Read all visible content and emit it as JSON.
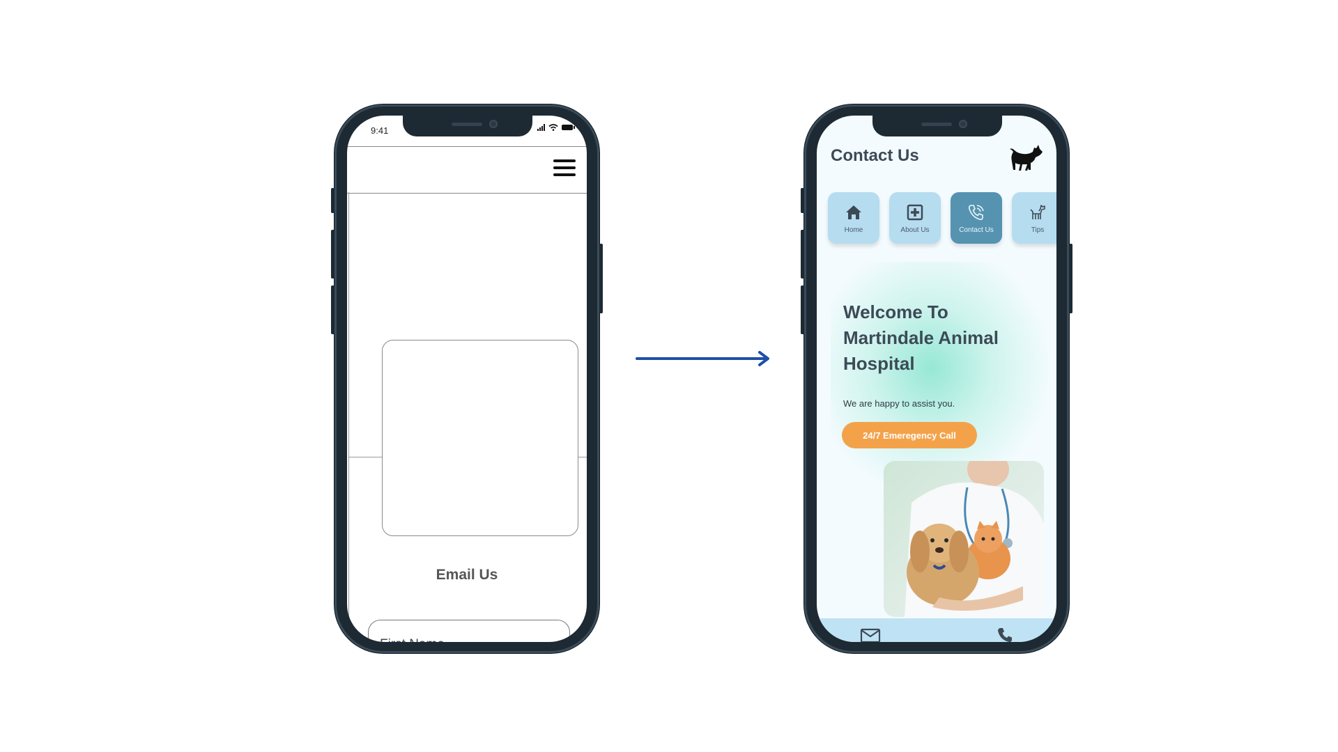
{
  "wireframe": {
    "status_time": "9:41",
    "section_title": "Email Us",
    "first_name_placeholder": "First Name"
  },
  "design": {
    "page_title": "Contact Us",
    "nav": [
      {
        "label": "Home",
        "icon": "home-icon"
      },
      {
        "label": "About Us",
        "icon": "medical-plus-icon"
      },
      {
        "label": "Contact Us",
        "icon": "phone-call-icon",
        "active": true
      },
      {
        "label": "Tips",
        "icon": "dog-icon"
      }
    ],
    "hero_title": "Welcome To Martindale Animal Hospital",
    "hero_subtitle": "We are happy to assist you.",
    "cta_label": "24/7 Emeregency Call",
    "colors": {
      "accent": "#f4a24a",
      "nav_button": "#b6dcef",
      "nav_active": "#5593b1",
      "bottom_bar": "#bfe3f4",
      "arrow": "#1f4fa8",
      "title_text": "#3d4a56"
    }
  }
}
